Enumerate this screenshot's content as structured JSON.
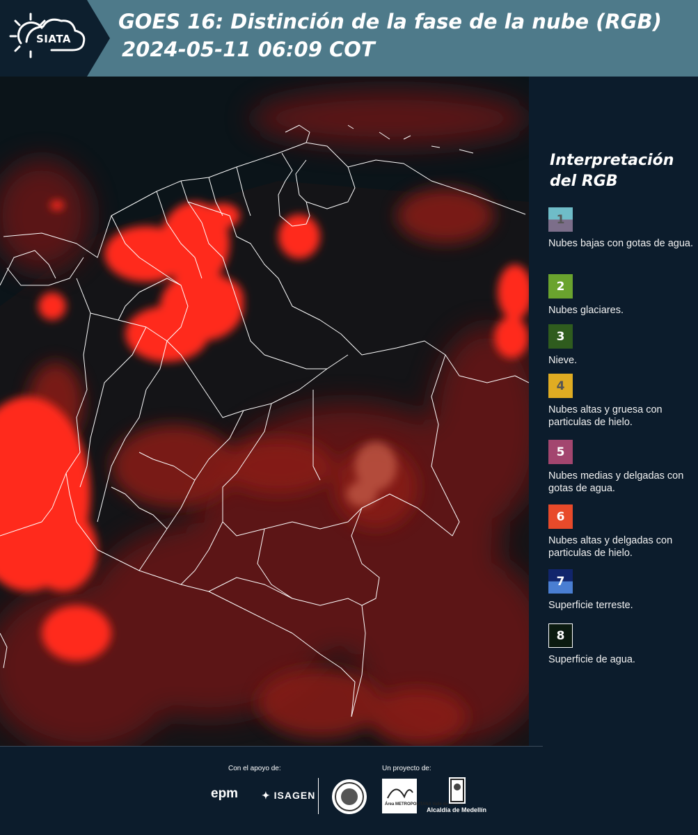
{
  "header": {
    "logo_text": "SIATA",
    "title_line1": "GOES 16: Distinción de la fase de la nube (RGB)",
    "title_line2": "2024-05-11 06:09 COT"
  },
  "legend": {
    "title": "Interpretación del RGB",
    "items": [
      {
        "number": "1",
        "label": "Nubes bajas con gotas de agua.",
        "colors": [
          "#6fbcc8",
          "#7c6e8a"
        ],
        "text_color": "#555555"
      },
      {
        "number": "2",
        "label": "Nubes glaciares.",
        "colors": [
          "#6aa32e"
        ],
        "text_color": "#ffffff"
      },
      {
        "number": "3",
        "label": "Nieve.",
        "colors": [
          "#2f5c1e"
        ],
        "text_color": "#ffffff"
      },
      {
        "number": "4",
        "label": "Nubes altas y gruesa con particulas de hielo.",
        "colors": [
          "#e0ac22"
        ],
        "text_color": "#555555"
      },
      {
        "number": "5",
        "label": "Nubes medias y delgadas con gotas de agua.",
        "colors": [
          "#a3466f"
        ],
        "text_color": "#ffffff"
      },
      {
        "number": "6",
        "label": "Nubes altas y delgadas con particulas de hielo.",
        "colors": [
          "#e84a2a"
        ],
        "text_color": "#ffffff"
      },
      {
        "number": "7",
        "label": "Superficie terreste.",
        "colors": [
          "#11256c",
          "#4a7ed2"
        ],
        "text_color": "#ffffff"
      },
      {
        "number": "8",
        "label": "Superficie de agua.",
        "colors": [
          "#0b1a10"
        ],
        "text_color": "#ffffff"
      }
    ]
  },
  "footer": {
    "support_label": "Con el apoyo de:",
    "project_label": "Un proyecto de:",
    "sponsors": {
      "epm": "epm",
      "isagen": "ISAGEN"
    },
    "partners": {
      "area_metropolitana": "Área METROPOLITANA Valle de Aburrá",
      "alcaldia": "Alcaldía de Medellín"
    }
  },
  "colors": {
    "header_bg": "#4e7a8a",
    "page_bg": "#0c1c2c",
    "cloud_red": "#ff2a1e",
    "borders": "#ffffff"
  }
}
